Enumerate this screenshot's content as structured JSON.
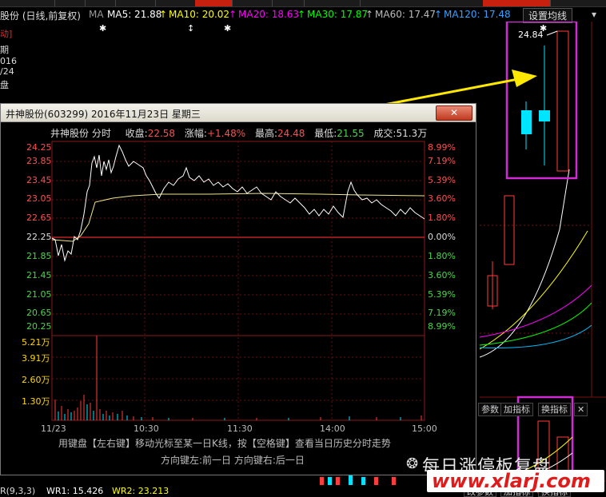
{
  "topbar": {
    "active_tab": "日线"
  },
  "ma_bar": {
    "stock_title": "股份 (日线,前复权)",
    "ma_label": "MA",
    "ma5": "MA5: 21.88",
    "ma10": "MA10: 20.02",
    "ma20": "MA20: 18.63",
    "ma30": "MA30: 17.87",
    "ma60": "MA60: 17.47",
    "ma120": "MA120: 17.48",
    "settings_button": "设置均线"
  },
  "left_info": [
    "动]",
    "期",
    "016",
    "/24",
    "盘"
  ],
  "kline": {
    "high_label": "24.84",
    "colors": {
      "up": "#ff3c3c",
      "down": "#00e5ff",
      "ma5": "#ffffff",
      "ma10": "#ffff00",
      "ma20": "#ff00ff",
      "ma30": "#00ff00",
      "annotation": "#d12bd6",
      "arrow": "#ffe800"
    }
  },
  "dialog": {
    "title": "井神股份(603299) 2016年11月23日 星期三",
    "close_label": "✕",
    "info": {
      "name": "井神股份 分时",
      "close_label": "收盘:",
      "close_value": "22.58",
      "change_label": "涨幅:",
      "change_value": "+1.48%",
      "high_label": "最高:",
      "high_value": "24.48",
      "low_label": "最低:",
      "low_value": "21.55",
      "volume_label": "成交:",
      "volume_value": "51.3万"
    },
    "price_axis": [
      "24.25",
      "23.85",
      "23.45",
      "23.05",
      "22.65",
      "22.25",
      "21.85",
      "21.45",
      "21.05",
      "20.65",
      "20.25"
    ],
    "pct_axis": [
      "8.99%",
      "7.19%",
      "5.39%",
      "3.60%",
      "1.80%",
      "0.00%",
      "1.80%",
      "3.60%",
      "5.39%",
      "7.19%",
      "8.99%"
    ],
    "volume_axis": [
      "5.21万",
      "3.91万",
      "2.60万",
      "1.30万"
    ],
    "time_axis": [
      "11/23",
      "10:30",
      "11:30",
      "14:00",
      "15:00"
    ],
    "hint_line1": "用键盘【左右键】移动光标至某一日K线，按【空格键】查看当日历史分时走势",
    "hint_line2": "方向键左:前一日    方向键右:后一日"
  },
  "indicator_buttons": {
    "param": "参数",
    "add": "加指标",
    "switch": "换指标",
    "close": "✕",
    "param2": "改参数",
    "add2": "加指标",
    "switch2": "换指标"
  },
  "bottom_bar": {
    "label": "R(9,3,3)",
    "wr1": "WR1: 15.426",
    "wr2": "WR2: 23.213"
  },
  "watermark": {
    "text": "每日涨停板复盘",
    "site": "www.xlarj.com"
  }
}
